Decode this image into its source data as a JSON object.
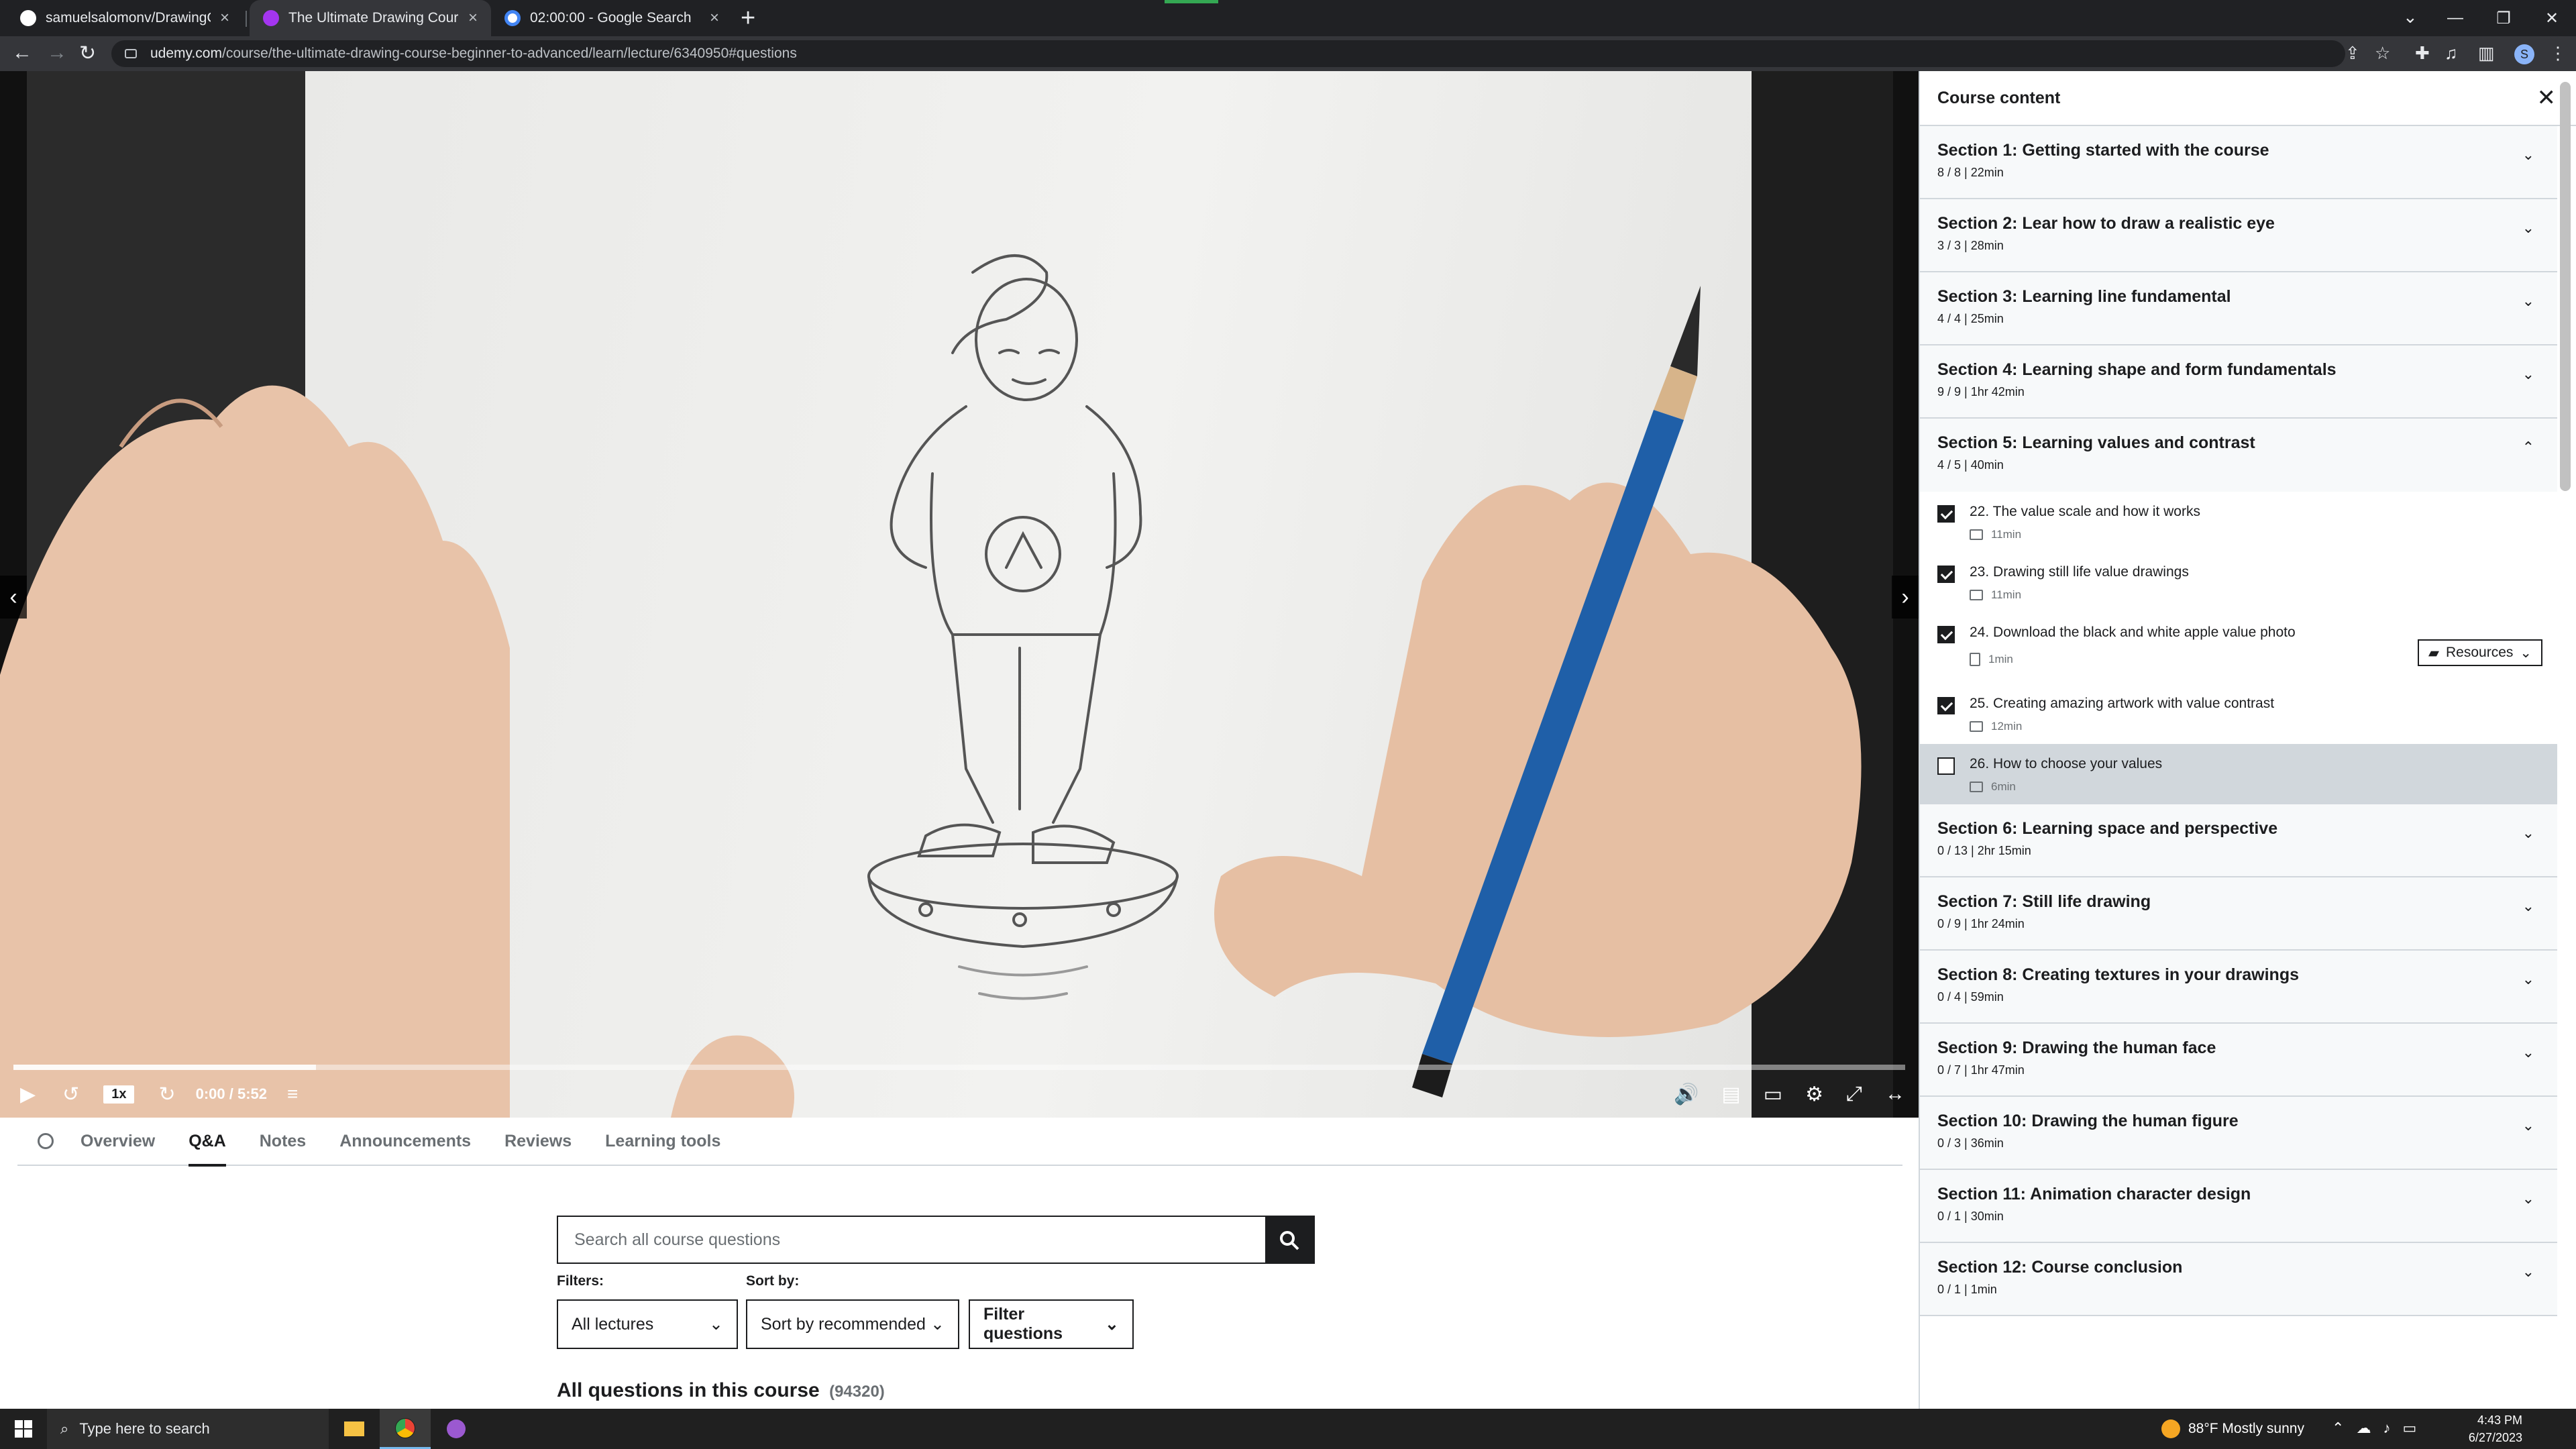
{
  "browser": {
    "tabs": [
      {
        "title": "samuelsalomonv/DrawingCourse",
        "favicon_color": "#ffffff"
      },
      {
        "title": "The Ultimate Drawing Course - B",
        "favicon_color": "#a435f0"
      },
      {
        "title": "02:00:00 - Google Search",
        "favicon_color": "#ffffff"
      }
    ],
    "url_host": "udemy.com",
    "url_path": "/course/the-ultimate-drawing-course-beginner-to-advanced/learn/lecture/6340950#questions",
    "profile_initial": "S"
  },
  "player": {
    "speed": "1x",
    "time": "0:00 / 5:52",
    "buffered_fraction": 0.16
  },
  "course_tabs": [
    "Overview",
    "Q&A",
    "Notes",
    "Announcements",
    "Reviews",
    "Learning tools"
  ],
  "qa": {
    "search_placeholder": "Search all course questions",
    "filters_label": "Filters:",
    "sort_label": "Sort by:",
    "filter_lectures": "All lectures",
    "sort_value": "Sort by recommended",
    "filter_questions": "Filter questions",
    "all_questions_title": "All questions in this course",
    "all_questions_count": "(94320)"
  },
  "sidebar": {
    "title": "Course content",
    "sections_before": [
      {
        "title": "Section 1: Getting started with the course",
        "meta": "8 / 8 | 22min"
      },
      {
        "title": "Section 2: Lear how to draw a realistic eye",
        "meta": "3 / 3 | 28min"
      },
      {
        "title": "Section 3: Learning line fundamental",
        "meta": "4 / 4 | 25min"
      },
      {
        "title": "Section 4: Learning shape and form fundamentals",
        "meta": "9 / 9 | 1hr 42min"
      }
    ],
    "open_section": {
      "title": "Section 5: Learning values and contrast",
      "meta": "4 / 5 | 40min"
    },
    "lectures": [
      {
        "title": "22. The value scale and how it works",
        "duration": "11min",
        "done": true,
        "kind": "video"
      },
      {
        "title": "23. Drawing still life value drawings",
        "duration": "11min",
        "done": true,
        "kind": "video"
      },
      {
        "title": "24. Download the black and white apple value photo",
        "duration": "1min",
        "done": true,
        "kind": "file"
      },
      {
        "title": "25. Creating amazing artwork with value contrast",
        "duration": "12min",
        "done": true,
        "kind": "video"
      },
      {
        "title": "26. How to choose your values",
        "duration": "6min",
        "done": false,
        "kind": "video"
      }
    ],
    "resources_label": "Resources",
    "sections_after": [
      {
        "title": "Section 6: Learning space and perspective",
        "meta": "0 / 13 | 2hr 15min"
      },
      {
        "title": "Section 7: Still life drawing",
        "meta": "0 / 9 | 1hr 24min"
      },
      {
        "title": "Section 8: Creating textures in your drawings",
        "meta": "0 / 4 | 59min"
      },
      {
        "title": "Section 9: Drawing the human face",
        "meta": "0 / 7 | 1hr 47min"
      },
      {
        "title": "Section 10: Drawing the human figure",
        "meta": "0 / 3 | 36min"
      },
      {
        "title": "Section 11: Animation character design",
        "meta": "0 / 1 | 30min"
      },
      {
        "title": "Section 12: Course conclusion",
        "meta": "0 / 1 | 1min"
      }
    ]
  },
  "taskbar": {
    "search_placeholder": "Type here to search",
    "weather": "88°F  Mostly sunny",
    "time": "4:43 PM",
    "date": "6/27/2023"
  }
}
